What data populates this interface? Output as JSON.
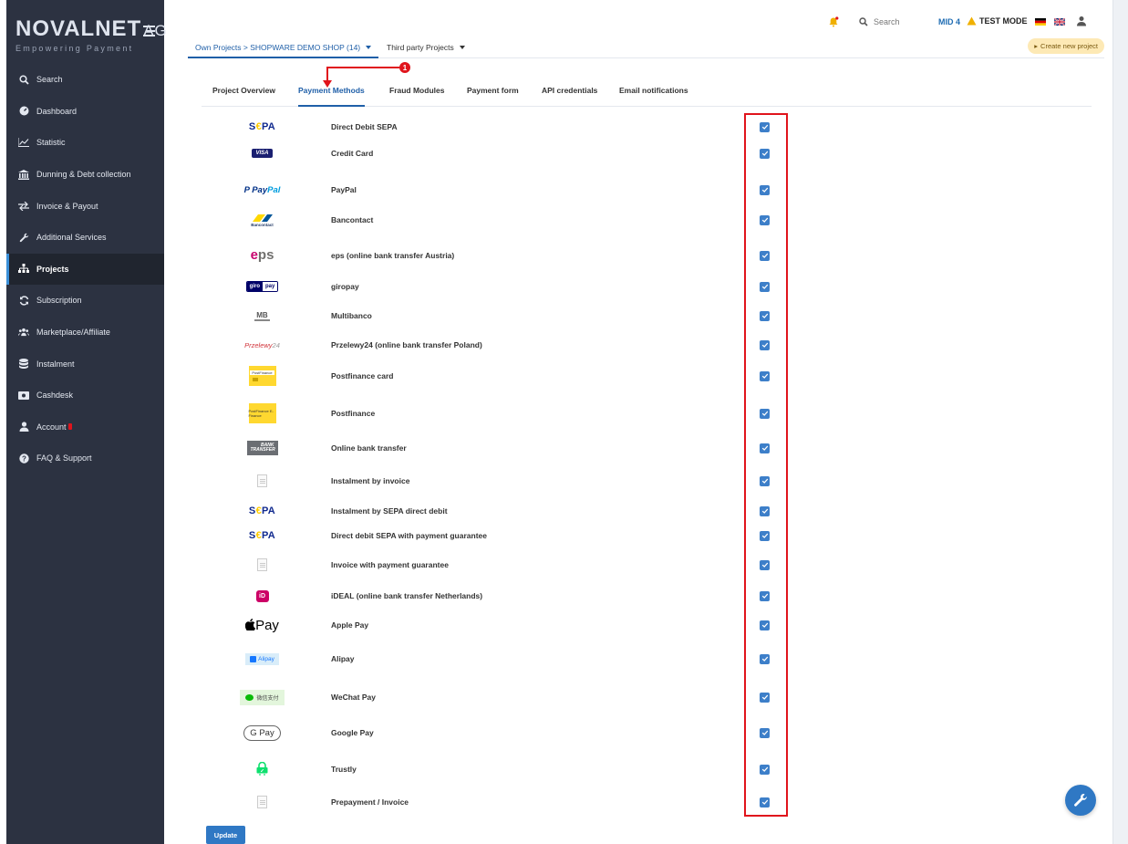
{
  "brand": {
    "name": "NOVALNET",
    "suffix": "AG",
    "tagline": "Empowering Payment"
  },
  "sidebar": {
    "items": [
      {
        "label": "Search",
        "icon": "search-icon"
      },
      {
        "label": "Dashboard",
        "icon": "dashboard-icon"
      },
      {
        "label": "Statistic",
        "icon": "chart-icon"
      },
      {
        "label": "Dunning & Debt collection",
        "icon": "bank-icon"
      },
      {
        "label": "Invoice & Payout",
        "icon": "transfer-icon"
      },
      {
        "label": "Additional Services",
        "icon": "wrench-icon"
      },
      {
        "label": "Projects",
        "icon": "sitemap-icon",
        "active": true
      },
      {
        "label": "Subscription",
        "icon": "refresh-icon"
      },
      {
        "label": "Marketplace/Affiliate",
        "icon": "users-icon"
      },
      {
        "label": "Instalment",
        "icon": "database-icon"
      },
      {
        "label": "Cashdesk",
        "icon": "cash-icon"
      },
      {
        "label": "Account",
        "icon": "user-icon"
      },
      {
        "label": "FAQ & Support",
        "icon": "question-icon"
      }
    ]
  },
  "topbar": {
    "search_label": "Search",
    "mid": "MID 4",
    "test_mode": "TEST MODE"
  },
  "projectbar": {
    "own_projects": "Own Projects > SHOPWARE DEMO SHOP (14)",
    "third_party": "Third party Projects",
    "create_button": "Create new project"
  },
  "tabs": [
    {
      "label": "Project Overview"
    },
    {
      "label": "Payment Methods",
      "active": true
    },
    {
      "label": "Fraud Modules"
    },
    {
      "label": "Payment form"
    },
    {
      "label": "API credentials"
    },
    {
      "label": "Email notifications"
    }
  ],
  "annotation": {
    "number": "1"
  },
  "payment_methods": [
    {
      "name": "Direct Debit SEPA",
      "logo": "sepa",
      "logo_text": "SEPA",
      "checked": true
    },
    {
      "name": "Credit Card",
      "logo": "visa",
      "logo_text": "VISA",
      "checked": true
    },
    {
      "name": "PayPal",
      "logo": "paypal",
      "logo_text": "PayPal",
      "checked": true
    },
    {
      "name": "Bancontact",
      "logo": "bancontact",
      "logo_text": "Bancontact",
      "checked": true
    },
    {
      "name": "eps (online bank transfer Austria)",
      "logo": "eps",
      "logo_text": "eps",
      "checked": true
    },
    {
      "name": "giropay",
      "logo": "giropay",
      "logo_text": "giropay",
      "checked": true
    },
    {
      "name": "Multibanco",
      "logo": "multibanco",
      "logo_text": "MB",
      "checked": true
    },
    {
      "name": "Przelewy24 (online bank transfer Poland)",
      "logo": "przelewy24",
      "logo_text": "Przelewy24",
      "checked": true
    },
    {
      "name": "Postfinance card",
      "logo": "postfinance-card",
      "logo_text": "PostFinance",
      "checked": true
    },
    {
      "name": "Postfinance",
      "logo": "postfinance",
      "logo_text": "PostFinance E-Finance",
      "checked": true
    },
    {
      "name": "Online bank transfer",
      "logo": "bank-transfer",
      "logo_text": "BANK TRANSFER",
      "checked": true
    },
    {
      "name": "Instalment by invoice",
      "logo": "document",
      "logo_text": "",
      "checked": true
    },
    {
      "name": "Instalment by SEPA direct debit",
      "logo": "sepa",
      "logo_text": "SEPA",
      "checked": true
    },
    {
      "name": "Direct debit SEPA with payment guarantee",
      "logo": "sepa",
      "logo_text": "SEPA",
      "checked": true
    },
    {
      "name": "Invoice with payment guarantee",
      "logo": "document",
      "logo_text": "",
      "checked": true
    },
    {
      "name": "iDEAL (online bank transfer Netherlands)",
      "logo": "ideal",
      "logo_text": "iD",
      "checked": true
    },
    {
      "name": "Apple Pay",
      "logo": "applepay",
      "logo_text": "Pay",
      "checked": true
    },
    {
      "name": "Alipay",
      "logo": "alipay",
      "logo_text": "Alipay",
      "checked": true
    },
    {
      "name": "WeChat Pay",
      "logo": "wechat",
      "logo_text": "微信支付",
      "checked": true
    },
    {
      "name": "Google Pay",
      "logo": "gpay",
      "logo_text": "G Pay",
      "checked": true
    },
    {
      "name": "Trustly",
      "logo": "trustly",
      "logo_text": "",
      "checked": true
    },
    {
      "name": "Prepayment / Invoice",
      "logo": "document",
      "logo_text": "",
      "checked": true
    }
  ],
  "footer": {
    "update_button": "Update"
  },
  "colors": {
    "sidebar_bg": "#2c3241",
    "accent": "#1f5fa8",
    "checkbox": "#3d7fc9",
    "highlight": "#e0141c"
  }
}
